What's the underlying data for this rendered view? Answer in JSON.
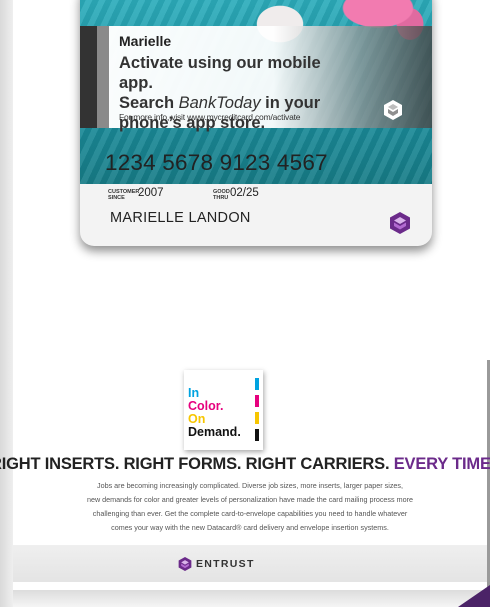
{
  "card": {
    "name": "Marielle",
    "message_line1": "Activate using our mobile app.",
    "message_search": "Search ",
    "message_app": "BankToday",
    "message_in_your": " in your",
    "message_line3": "phone’s app store.",
    "url_note": "For more info, visit www.mycreditcard.com/activate",
    "number": "1234 5678 9123 4567",
    "customer_since_label_1": "CUSTOMER",
    "customer_since_label_2": "SINCE",
    "customer_since_value": "2007",
    "good_thru_label_1": "GOOD",
    "good_thru_label_2": "THRU",
    "good_thru_value": "02/25",
    "holder": "MARIELLE  LANDON"
  },
  "poster": {
    "line1": "In",
    "line2": "Color.",
    "line3": "On",
    "line4": "Demand."
  },
  "ad": {
    "headline_part1": "RIGHT INSERTS. RIGHT FORMS. RIGHT CARRIERS. ",
    "headline_part2": "EVERY TIME.",
    "body_line1": "Jobs are becoming increasingly complicated. Diverse job sizes, more inserts, larger paper sizes,",
    "body_line2": "new demands for color and greater levels of personalization have made the card mailing process more",
    "body_line3": "challenging than ever. Get the complete card-to-envelope capabilities you need to handle whatever",
    "body_line4": "comes your way with the new Datacard® card delivery and envelope insertion systems.",
    "logo": "ENTRUST"
  },
  "colors": {
    "brand_purple": "#6b2a8a",
    "cyan": "#00a3e0",
    "magenta": "#e6007e",
    "yellow": "#f7c600",
    "black": "#111111"
  }
}
